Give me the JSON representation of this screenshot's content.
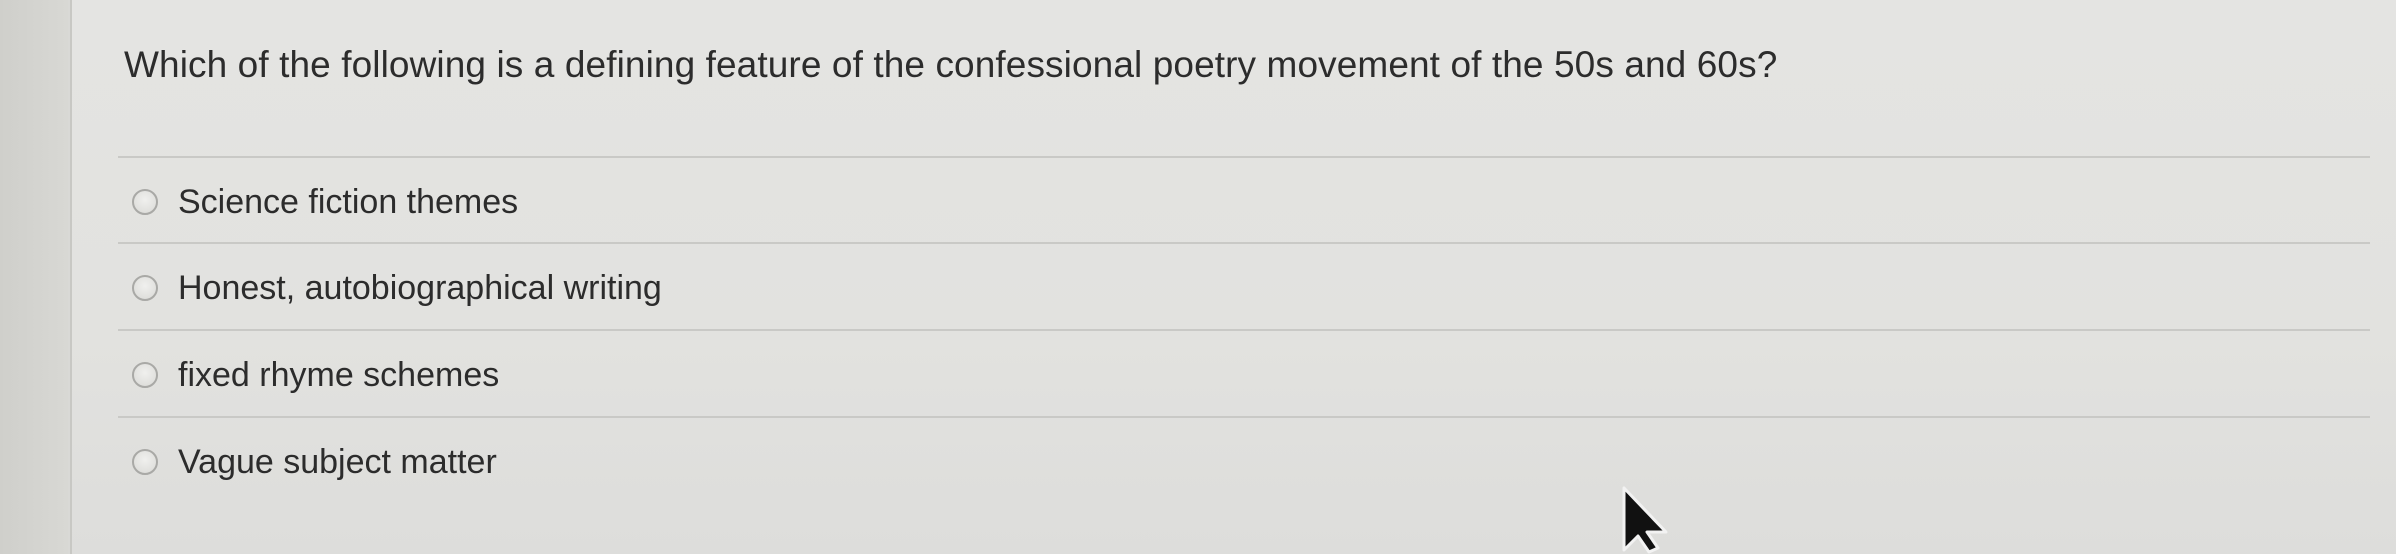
{
  "quiz": {
    "question": "Which of the following is a defining feature of the confessional poetry movement of the 50s and 60s?",
    "options": [
      {
        "label": "Science fiction themes",
        "selected": false
      },
      {
        "label": "Honest, autobiographical writing",
        "selected": false
      },
      {
        "label": "fixed rhyme schemes",
        "selected": false
      },
      {
        "label": "Vague subject matter",
        "selected": false
      }
    ]
  },
  "icons": {
    "radio": "radio-button-unchecked-icon",
    "cursor": "mouse-pointer-icon"
  },
  "colors": {
    "text": "#2c2c2c",
    "background": "#e2e2df",
    "divider": "#c9c9c6"
  }
}
